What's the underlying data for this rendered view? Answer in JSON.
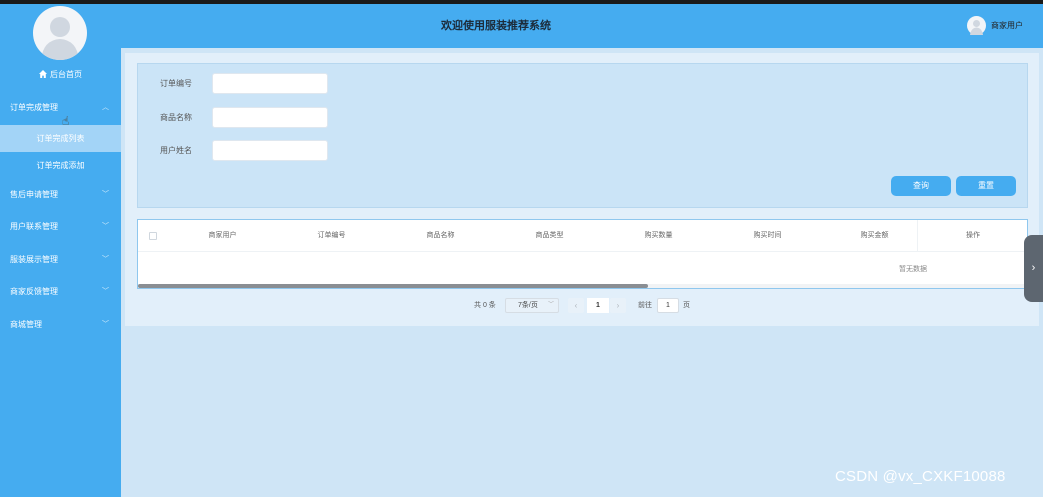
{
  "header": {
    "title": "欢迎使用服装推荐系统",
    "user_name": "商家用户"
  },
  "sidebar": {
    "home_label": "后台首页",
    "menus": [
      {
        "label": "订单完成管理",
        "expanded": true,
        "children": [
          {
            "label": "订单完成列表",
            "active": true
          },
          {
            "label": "订单完成添加",
            "active": false
          }
        ]
      },
      {
        "label": "售后申请管理",
        "expanded": false
      },
      {
        "label": "用户联系管理",
        "expanded": false
      },
      {
        "label": "服装展示管理",
        "expanded": false
      },
      {
        "label": "商家反馈管理",
        "expanded": false
      },
      {
        "label": "商城管理",
        "expanded": false
      }
    ]
  },
  "search": {
    "fields": [
      {
        "label": "订单编号",
        "value": "",
        "placeholder": ""
      },
      {
        "label": "商品名称",
        "value": "",
        "placeholder": ""
      },
      {
        "label": "用户姓名",
        "value": "",
        "placeholder": ""
      }
    ],
    "query_label": "查询",
    "reset_label": "重置"
  },
  "table": {
    "columns": [
      "商家用户",
      "订单编号",
      "商品名称",
      "商品类型",
      "购买数量",
      "购买时间",
      "购买金额"
    ],
    "op_column": "操作",
    "empty_text": "暂无数据",
    "rows": []
  },
  "pagination": {
    "total_text": "共 0 条",
    "page_size": "7条/页",
    "current_page": "1",
    "goto_label": "前往",
    "goto_value": "1",
    "page_unit": "页"
  },
  "watermark": "CSDN @vx_CXKF10088",
  "colors": {
    "primary": "#45acf0",
    "background": "#cfe5f6",
    "active_submenu": "#a3d4f7"
  }
}
